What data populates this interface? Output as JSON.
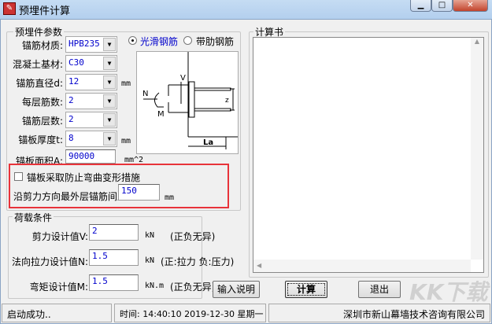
{
  "window": {
    "title": "预埋件计算",
    "min": "▁",
    "max": "□",
    "close": "✕",
    "icon": "app-icon"
  },
  "params": {
    "group_label": "预埋件参数",
    "material_label": "锚筋材质:",
    "material_value": "HPB235",
    "concrete_label": "混凝土基材:",
    "concrete_value": "C30",
    "diameter_label": "锚筋直径d:",
    "diameter_value": "12",
    "diameter_unit": "mm",
    "per_layer_label": "每层筋数:",
    "per_layer_value": "2",
    "layers_label": "锚筋层数:",
    "layers_value": "2",
    "thickness_label": "锚板厚度t:",
    "thickness_value": "8",
    "thickness_unit": "mm",
    "area_label": "锚板面积A:",
    "area_value": "90000",
    "area_unit": "mm^2",
    "radio_smooth": "光滑钢筋",
    "radio_ribbed": "带肋钢筋",
    "selected": "光滑钢筋",
    "checkbox_label": "锚板采取防止弯曲变形措施",
    "checkbox_checked": false,
    "spacing_label": "沿剪力方向最外层锚筋间距z:",
    "spacing_value": "150",
    "spacing_unit": "mm",
    "diagram": {
      "V": "V",
      "N": "N",
      "M": "M",
      "z": "z",
      "La": "La"
    }
  },
  "loads": {
    "group_label": "荷载条件",
    "shear_label": "剪力设计值V:",
    "shear_value": "2",
    "shear_unit": "kN",
    "shear_note": "(正负无异)",
    "tension_label": "法向拉力设计值N:",
    "tension_value": "1.5",
    "tension_unit": "kN",
    "tension_note": "(正:拉力 负:压力)",
    "moment_label": "弯矩设计值M:",
    "moment_value": "1.5",
    "moment_unit": "kN.m",
    "moment_note": "(正负无异)"
  },
  "output": {
    "group_label": "计算书",
    "text": ""
  },
  "buttons": {
    "help": "输入说明",
    "calc": "计算",
    "exit": "退出"
  },
  "status": {
    "message": "启动成功..",
    "time": "时间: 14:40:10 2019-12-30 星期一",
    "company": "深圳市新山幕墙技术咨询有限公司"
  },
  "watermark": "KK下载"
}
